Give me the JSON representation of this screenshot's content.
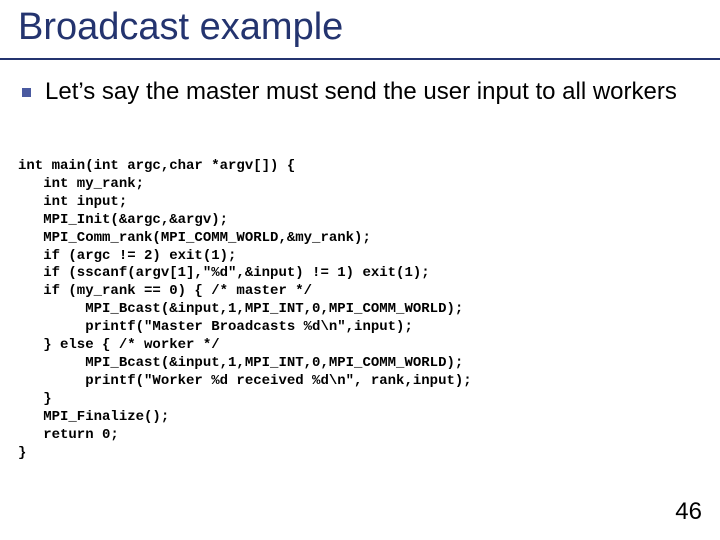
{
  "title": "Broadcast example",
  "bullet": "Let’s say the master must send the user input to all workers",
  "code": "int main(int argc,char *argv[]) {\n   int my_rank;\n   int input;\n   MPI_Init(&argc,&argv);\n   MPI_Comm_rank(MPI_COMM_WORLD,&my_rank);\n   if (argc != 2) exit(1);\n   if (sscanf(argv[1],\"%d\",&input) != 1) exit(1);\n   if (my_rank == 0) { /* master */\n        MPI_Bcast(&input,1,MPI_INT,0,MPI_COMM_WORLD);\n        printf(\"Master Broadcasts %d\\n\",input);\n   } else { /* worker */\n        MPI_Bcast(&input,1,MPI_INT,0,MPI_COMM_WORLD);\n        printf(\"Worker %d received %d\\n\", rank,input);\n   }\n   MPI_Finalize();\n   return 0;\n}",
  "page_number": "46"
}
